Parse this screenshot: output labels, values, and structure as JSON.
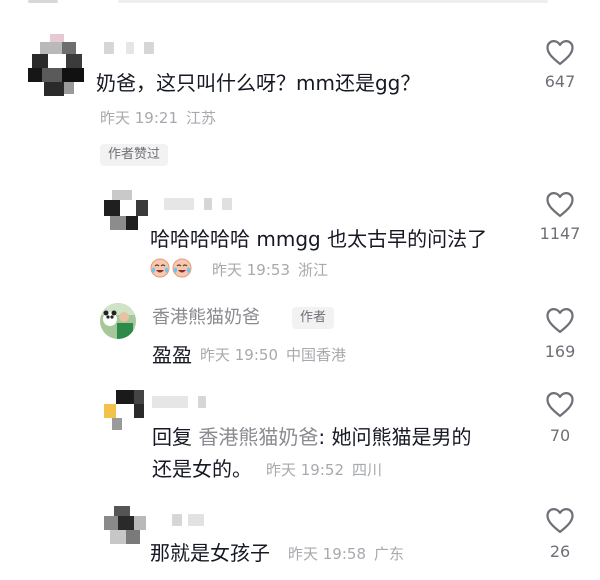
{
  "comments": [
    {
      "text": "奶爸，这只叫什么呀？mm还是gg？",
      "time": "昨天 19:21",
      "location": "江苏",
      "badge": "作者赞过",
      "likes": "647"
    },
    {
      "text": "哈哈哈哈哈 mmgg 也太古早的问法了",
      "time": "昨天 19:53",
      "location": "浙江",
      "likes": "1147"
    },
    {
      "author": "香港熊猫奶爸",
      "author_tag": "作者",
      "text": "盈盈",
      "time": "昨天 19:50",
      "location": "中国香港",
      "likes": "169"
    },
    {
      "reply_prefix": "回复",
      "reply_target": "香港熊猫奶爸",
      "text_line1": ": 她问熊猫是男的",
      "text_line2": "还是女的。",
      "time": "昨天 19:52",
      "location": "四川",
      "likes": "70"
    },
    {
      "text": "那就是女孩子",
      "time": "昨天 19:58",
      "location": "广东",
      "likes": "26"
    }
  ],
  "icons": {
    "like": "heart-outline-icon",
    "reaction": "crying-laughing-emoji-icon"
  },
  "colors": {
    "text": "#161823",
    "meta": "#a7a9ad",
    "count": "#6f7077",
    "chip_bg": "#f2f2f3"
  }
}
